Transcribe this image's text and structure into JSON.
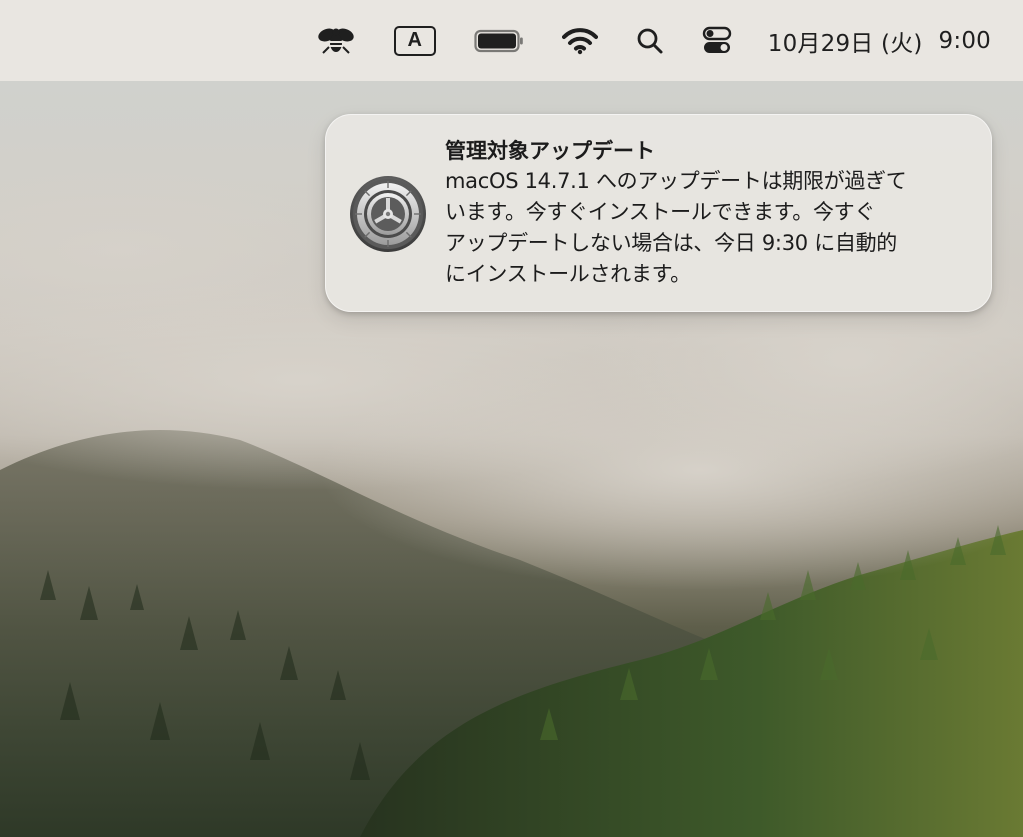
{
  "menubar": {
    "icons": [
      "bee-icon",
      "input-source-icon",
      "battery-icon",
      "wifi-icon",
      "search-icon",
      "control-center-icon"
    ],
    "input_source_label": "A",
    "date": "10月29日 (火)",
    "time": "9:00"
  },
  "notification": {
    "app_icon": "system-settings-gear-icon",
    "title": "管理対象アップデート",
    "body_lines": [
      "macOS 14.7.1 へのアップデートは期限が過ぎて",
      "います。今すぐインストールできます。今すぐ",
      "アップデートしない場合は、今日 9:30 に自動的",
      "にインストールされます。"
    ]
  },
  "colors": {
    "menubar_bg": "#e9e6e1",
    "notification_bg": "#e8e6e2",
    "text": "#1c1c1c"
  }
}
